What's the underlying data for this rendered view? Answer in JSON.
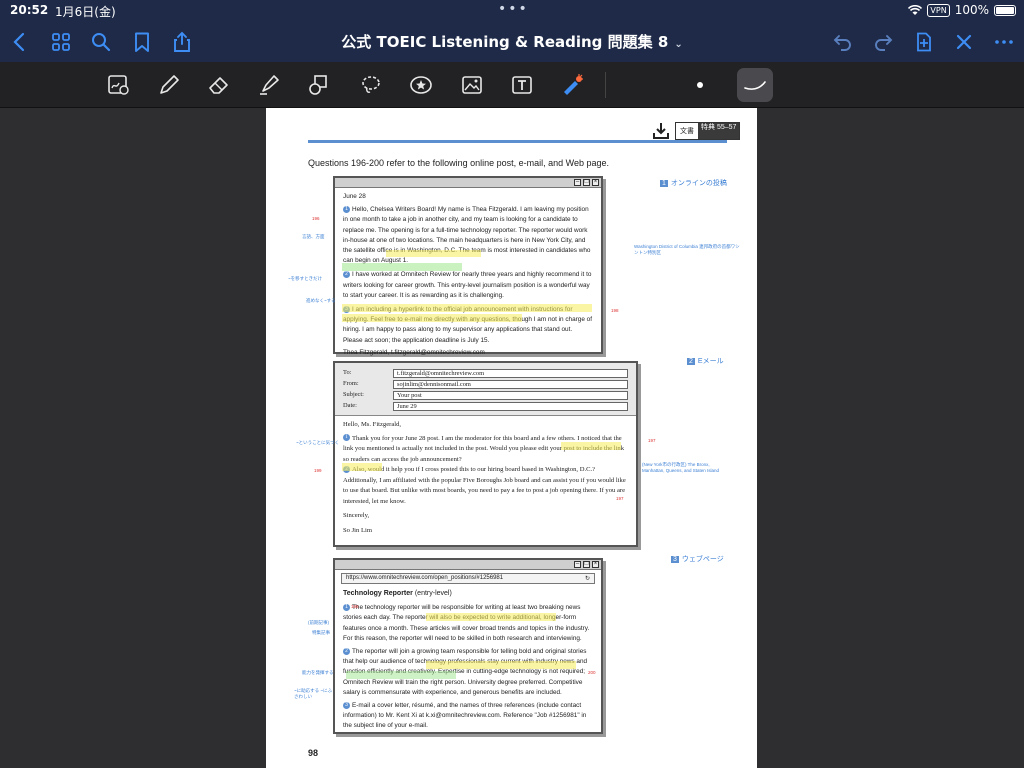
{
  "status_bar": {
    "time": "20:52",
    "date": "1月6日(金)",
    "vpn": "VPN",
    "battery": "100%"
  },
  "nav": {
    "title": "公式 TOEIC Listening & Reading 問題集 8",
    "title_chevron": "⌄"
  },
  "document": {
    "tag_label": "文書",
    "tag_sub": "特典 55–57",
    "question_line": "Questions 196-200 refer to the following online post, e-mail, and Web page.",
    "page_number": "98",
    "section1_num": "1",
    "section1_label": "オンラインの投稿",
    "section2_num": "2",
    "section2_label": "Eメール",
    "section3_num": "3",
    "section3_label": "ウェブページ",
    "post": {
      "date": "June 28",
      "p1": "Hello, Chelsea Writers Board! My name is Thea Fitzgerald. I am leaving my position in one month to take a job in another city, and my team is looking for a candidate to replace me. The opening is for a full-time technology reporter. The reporter would work in-house at one of two locations. The main headquarters is here in New York City, and the satellite office is in Washington, D.C. The team is most interested in candidates who can begin on August 1.",
      "p2": "I have worked at Omnitech Review for nearly three years and highly recommend it to writers looking for career growth. This entry-level journalism position is a wonderful way to start your career. It is as rewarding as it is challenging.",
      "p3": "I am including a hyperlink to the official job announcement with instructions for applying. Feel free to e-mail me directly with any questions, though I am not in charge of hiring. I am happy to pass along to my supervisor any applications that stand out. Please act soon; the application deadline is July 15.",
      "sign": "Thea Fitzgerald, t.fitzgerald@omnitechreview.com"
    },
    "email": {
      "to_label": "To:",
      "to": "t.fitzgerald@omnitechreview.com",
      "from_label": "From:",
      "from": "sojinlim@dennisonmail.com",
      "subject_label": "Subject:",
      "subject": "Your post",
      "date_label": "Date:",
      "date": "June 29",
      "greeting": "Hello, Ms. Fitzgerald,",
      "p1": "Thank you for your June 28 post. I am the moderator for this board and a few others. I noticed that the link you mentioned is actually not included in the post. Would you please edit your post to include the link so readers can access the job announcement?",
      "p2": "Also, would it help you if I cross posted this to our hiring board based in Washington, D.C.? Additionally, I am affiliated with the popular Five Boroughs Job board and can assist you if you would like to use that board. But unlike with most boards, you need to pay a fee to post a job opening there. If you are interested, let me know.",
      "closing": "Sincerely,",
      "signature": "So Jin Lim"
    },
    "web": {
      "url": "https://www.omnitechreview.com/open_positions/#1256981",
      "heading": "Technology Reporter",
      "heading_sub": "(entry-level)",
      "p1": "The technology reporter will be responsible for writing at least two breaking news stories each day. The reporter will also be expected to write additional, longer-form features once a month. These articles will cover broad trends and topics in the industry. For this reason, the reporter will need to be skilled in both research and interviewing.",
      "p2": "The reporter will join a growing team responsible for telling bold and original stories that help our audience of technology professionals stay current with industry news and function efficiently and creatively. Expertise in cutting-edge technology is not required; Omnitech Review will train the right person. University degree preferred. Competitive salary is commensurate with experience, and generous benefits are included.",
      "p3": "E-mail a cover letter, résumé, and the names of three references (include contact information) to Mr. Kent Xi at k.xi@omnitechreview.com. Reference \"Job #1256981\" in the subject line of your e-mail."
    },
    "margin_notes": {
      "n196a": "196",
      "n196b": "196",
      "n198": "198",
      "n197": "197",
      "n199": "199",
      "n197b": "197",
      "n200": "200",
      "wash_note": "Washington District of Columbia 連邦政府の首都ワシントン特別区",
      "nyc_note": "(New York市の行政区) The Bronx, Manhattan, Queens, and Staten Island",
      "left1": "言語、方面",
      "left2": "~を移すときだけ",
      "left3": "進めなく~する",
      "left4": "~ということに気づく",
      "left5": "(前期記事)",
      "left6": "特集記事",
      "left7": "能力を発揮する",
      "left8": "~に助応する ~にふさわしい"
    }
  },
  "colors": {
    "nav_bg": "#1e2a47",
    "accent": "#3d8df5",
    "toolbar_bg": "#222224",
    "canvas_bg": "#2e2e30",
    "highlight_yellow": "#f5ec5a",
    "highlight_green": "#9ee68c",
    "annotation_blue": "#3b7fd4",
    "annotation_red": "#d33333"
  }
}
